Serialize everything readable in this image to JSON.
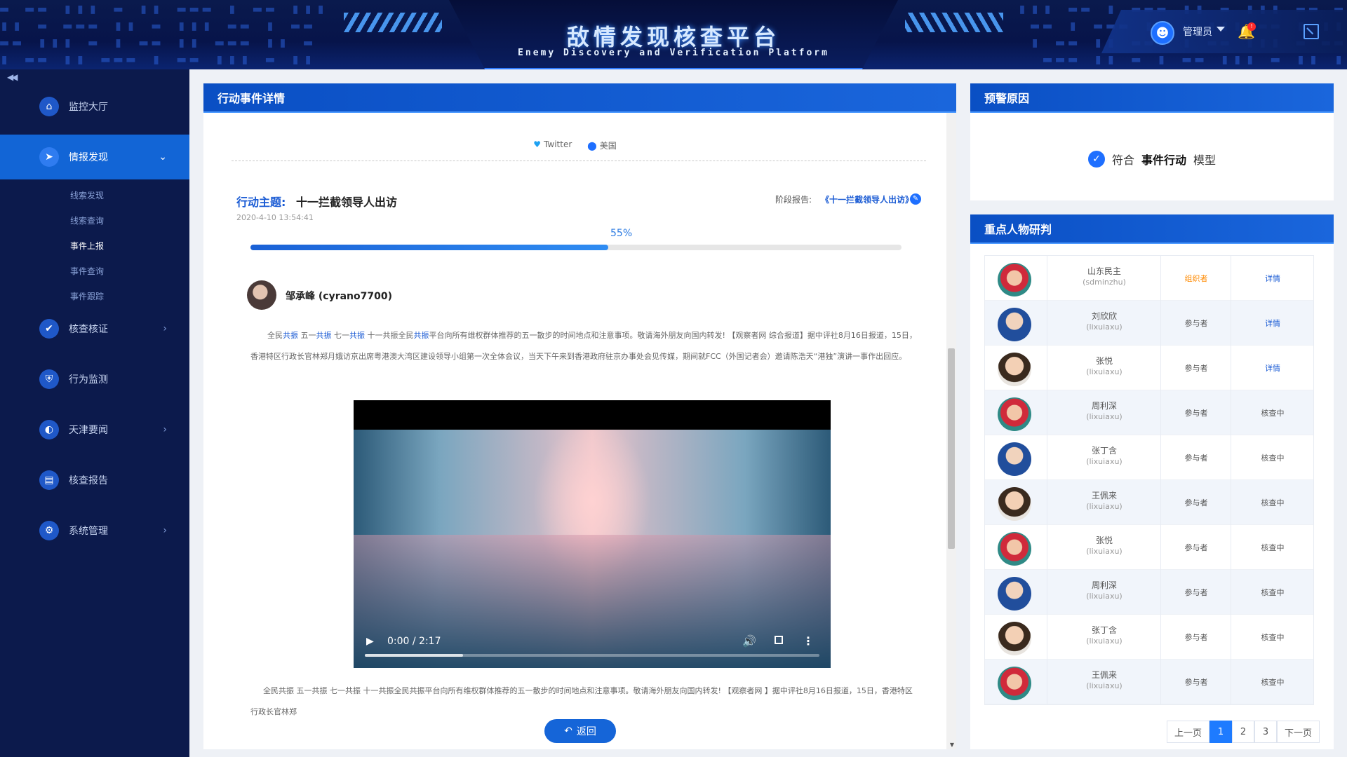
{
  "header": {
    "title": "敌情发现核查平台",
    "subtitle": "Enemy Discovery and Verification Platform",
    "user_label": "管理员"
  },
  "sidebar": {
    "collapse_label": "◀◀",
    "items": [
      {
        "label": "监控大厅",
        "icon": "home-icon"
      },
      {
        "label": "情报发现",
        "icon": "compass-icon",
        "active": true
      },
      {
        "label": "核查核证",
        "icon": "check-icon"
      },
      {
        "label": "行为监测",
        "icon": "shield-icon"
      },
      {
        "label": "天津要闻",
        "icon": "news-icon"
      },
      {
        "label": "核查报告",
        "icon": "report-icon"
      },
      {
        "label": "系统管理",
        "icon": "settings-icon"
      }
    ],
    "subitems": [
      "线索发现",
      "线索查询",
      "事件上报",
      "事件查询",
      "事件跟踪"
    ],
    "current_subitem": "事件上报"
  },
  "main": {
    "title": "行动事件详情",
    "source": "Twitter",
    "location": "美国",
    "topic_label": "行动主题:",
    "topic_value": "十一拦截领导人出访",
    "date": "2020-4-10 13:54:41",
    "stage_label": "阶段报告:",
    "stage_link": "《十一拦截领导人出访》",
    "progress_text": "55%",
    "progress_value": 0.55,
    "author": "邹承峰 (cyrano7700)",
    "article_parts": [
      {
        "t": "全民",
        "hl": false
      },
      {
        "t": "共振",
        "hl": true
      },
      {
        "t": " 五一",
        "hl": false
      },
      {
        "t": "共振",
        "hl": true
      },
      {
        "t": " 七一",
        "hl": false
      },
      {
        "t": "共振",
        "hl": true
      },
      {
        "t": " 十一共振全民",
        "hl": false
      },
      {
        "t": "共振",
        "hl": true
      },
      {
        "t": "平台向所有维权群体推荐的五一散步的时间地点和注意事项。敬请海外朋友向国内转发! 【观察者网 综合报道】据中评社8月16日报道，15日，香港特区行政长官林郑月娥访京出席粤港澳大湾区建设领导小组第一次全体会议，当天下午来到香港政府驻京办事处会见传媒，期间就FCC（外国记者会）邀请陈浩天“港独”演讲一事作出回应。",
        "hl": false
      }
    ],
    "video_time": "0:00 / 2:17",
    "article2": "全民共振 五一共振 七一共振 十一共振全民共振平台向所有维权群体推荐的五一散步的时间地点和注意事项。敬请海外朋友向国内转发! 【观察者网 】据中评社8月16日报道，15日，香港特区行政长官林郑",
    "back_label": "返回"
  },
  "warning": {
    "title": "预警原因",
    "prefix": "符合",
    "model": "事件行动",
    "suffix": "模型"
  },
  "persons": {
    "title": "重点人物研判",
    "rows": [
      {
        "name": "山东民主",
        "handle": "(sdminzhu)",
        "role": "组织者",
        "action": "详情",
        "avatar": "a"
      },
      {
        "name": "刘欣欣",
        "handle": "(lixuiaxu)",
        "role": "参与者",
        "action": "详情",
        "avatar": "b"
      },
      {
        "name": "张悦",
        "handle": "(lixuiaxu)",
        "role": "参与者",
        "action": "详情",
        "avatar": "c"
      },
      {
        "name": "周利深",
        "handle": "(lixuiaxu)",
        "role": "参与者",
        "action": "核查中",
        "avatar": "a"
      },
      {
        "name": "张丁含",
        "handle": "(lixuiaxu)",
        "role": "参与者",
        "action": "核查中",
        "avatar": "b"
      },
      {
        "name": "王佩来",
        "handle": "(lixuiaxu)",
        "role": "参与者",
        "action": "核查中",
        "avatar": "c"
      },
      {
        "name": "张悦",
        "handle": "(lixuiaxu)",
        "role": "参与者",
        "action": "核查中",
        "avatar": "a"
      },
      {
        "name": "周利深",
        "handle": "(lixuiaxu)",
        "role": "参与者",
        "action": "核查中",
        "avatar": "b"
      },
      {
        "name": "张丁含",
        "handle": "(lixuiaxu)",
        "role": "参与者",
        "action": "核查中",
        "avatar": "c"
      },
      {
        "name": "王佩来",
        "handle": "(lixuiaxu)",
        "role": "参与者",
        "action": "核查中",
        "avatar": "a"
      }
    ]
  },
  "pagination": {
    "prev": "上一页",
    "pages": [
      "1",
      "2",
      "3"
    ],
    "current": "1",
    "next": "下一页"
  },
  "colors": {
    "accent": "#1265d6",
    "header_bg": "#0a1a4d",
    "sidebar_bg": "#0c1a4c",
    "organizer": "#ff8a00",
    "link": "#1a5bd4"
  }
}
